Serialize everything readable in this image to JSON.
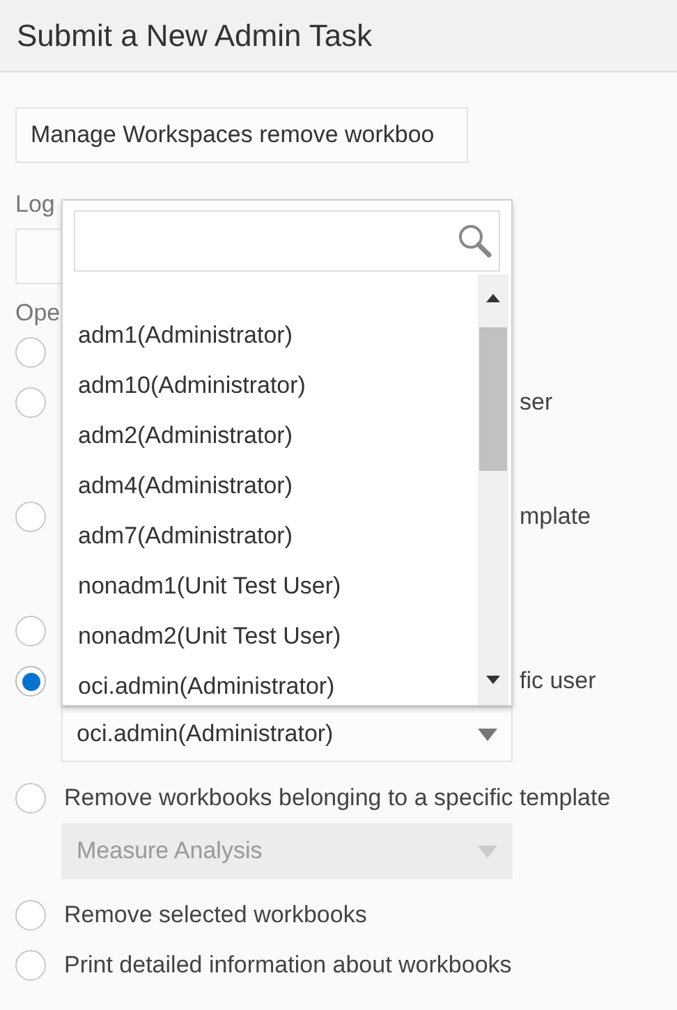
{
  "header": {
    "title": "Submit a New Admin Task"
  },
  "task_field": {
    "value": "Manage Workspaces remove workboo"
  },
  "log_level": {
    "label": "Log"
  },
  "operation": {
    "label": "Ope",
    "options": [
      {
        "selected": false
      },
      {
        "kind": "covered",
        "label": "ser",
        "selected": false
      },
      {
        "kind": "covered",
        "label": "mplate",
        "selected": false
      },
      {
        "selected": false
      },
      {
        "kind": "covered",
        "label": "fic user",
        "selected": true,
        "field": {
          "value": "oci.admin(Administrator)",
          "disabled": false
        }
      },
      {
        "kind": "plain",
        "label": "Remove workbooks belonging to a specific template",
        "selected": false,
        "field": {
          "value": "Measure Analysis",
          "disabled": true
        }
      },
      {
        "kind": "plain",
        "label": "Remove selected workbooks",
        "selected": false
      },
      {
        "kind": "plain",
        "label": "Print detailed information about workbooks",
        "selected": false
      }
    ]
  },
  "user_popup": {
    "items": [
      {
        "label": "adm1(Administrator)"
      },
      {
        "label": "adm10(Administrator)"
      },
      {
        "label": "adm2(Administrator)"
      },
      {
        "label": "adm4(Administrator)"
      },
      {
        "label": "adm7(Administrator)"
      },
      {
        "label": "nonadm1(Unit Test User)"
      },
      {
        "label": "nonadm2(Unit Test User)"
      },
      {
        "label": "oci.admin(Administrator)"
      }
    ]
  }
}
